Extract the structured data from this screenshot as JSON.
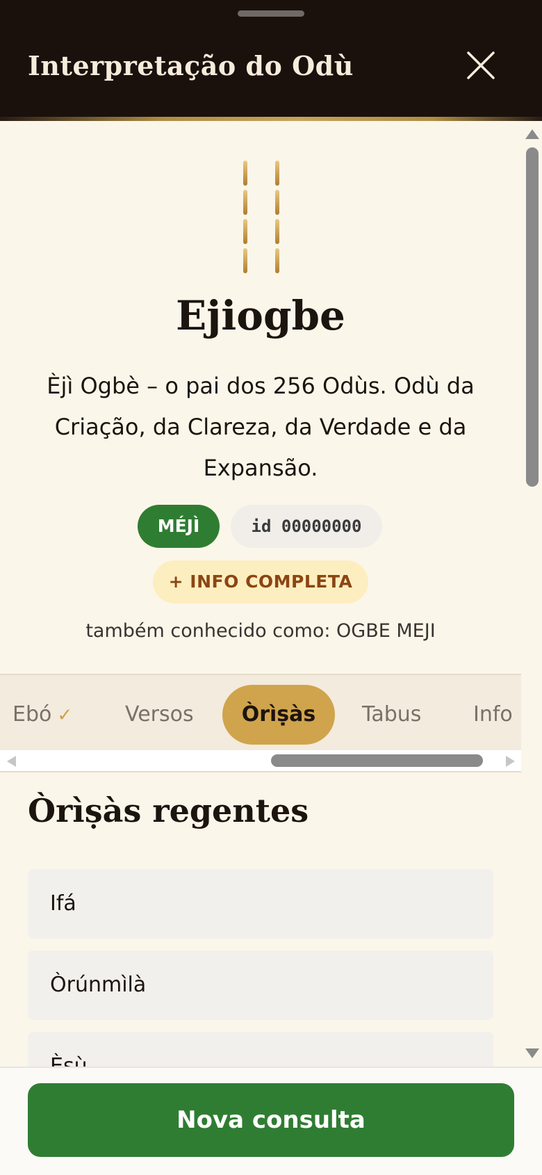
{
  "header": {
    "title": "Interpretação do Odù"
  },
  "odu": {
    "name": "Ejiogbe",
    "description": "Èjì Ogbè – o pai dos 256 Odùs. Odù da Criação, da Clareza, da Verdade e da Expansão.",
    "badge_label": "MÉJÌ",
    "id_label": "id 00000000",
    "info_button_label": "+ INFO COMPLETA",
    "also_known": "também conhecido como: OGBE MEJI",
    "figure_marks": [
      [
        1,
        1
      ],
      [
        1,
        1
      ],
      [
        1,
        1
      ],
      [
        1,
        1
      ]
    ]
  },
  "tabs": [
    {
      "label": "Ebó",
      "check": "✓"
    },
    {
      "label": "Versos"
    },
    {
      "label": "Òrìṣàs"
    },
    {
      "label": "Tabus"
    },
    {
      "label": "Info"
    }
  ],
  "active_tab": "Òrìṣàs",
  "section": {
    "title": "Òrìṣàs regentes",
    "items": [
      "Ifá",
      "Òrúnmìlà",
      "Èṣù"
    ]
  },
  "footer": {
    "button_label": "Nova consulta"
  },
  "colors": {
    "header_bg": "#1a110d",
    "content_bg": "#fbf6ea",
    "gold": "#d0a44c",
    "green": "#2f7d32",
    "info_text": "#8b4513"
  },
  "icons": {
    "close": "close-icon",
    "check": "check-icon"
  }
}
